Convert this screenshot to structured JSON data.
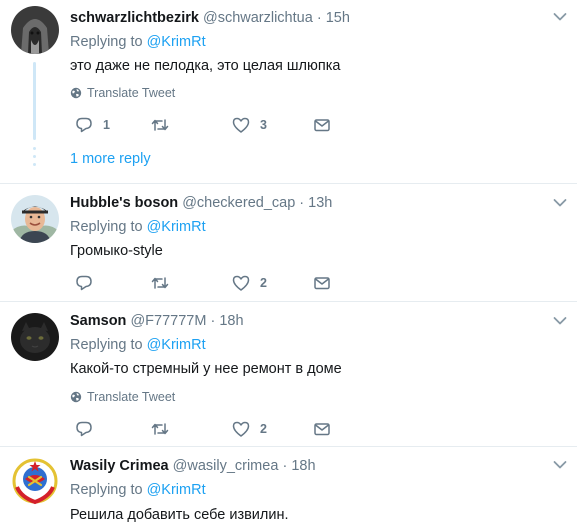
{
  "tweets": [
    {
      "name": "schwarzlichtbezirk",
      "handle": "@schwarzlichtua",
      "time": "15h",
      "replying_prefix": "Replying to",
      "mention": "@KrimRt",
      "text": "это даже не пелодка, это целая шлюпка",
      "translate": "Translate Tweet",
      "reply_count": "1",
      "retweet_count": "",
      "like_count": "3",
      "more_reply": "1 more reply"
    },
    {
      "name": "Hubble's boson",
      "handle": "@checkered_cap",
      "time": "13h",
      "replying_prefix": "Replying to",
      "mention": "@KrimRt",
      "text": "Громыко-style",
      "reply_count": "",
      "retweet_count": "",
      "like_count": "2"
    },
    {
      "name": "Samson",
      "handle": "@F77777M",
      "time": "18h",
      "replying_prefix": "Replying to",
      "mention": "@KrimRt",
      "text": "Какой-то стремный у нее ремонт в доме",
      "translate": "Translate Tweet",
      "reply_count": "",
      "retweet_count": "",
      "like_count": "2"
    },
    {
      "name": "Wasily Crimea",
      "handle": "@wasily_crimea",
      "time": "18h",
      "replying_prefix": "Replying to",
      "mention": "@KrimRt",
      "text": "Решила добавить себе извилин."
    }
  ],
  "separator": "·",
  "colors": {
    "accent": "#1da1f2",
    "muted": "#657786",
    "divider": "#e6ecf0",
    "thread": "#cfe7f7"
  },
  "icons": [
    "reply-icon",
    "retweet-icon",
    "like-icon",
    "message-icon",
    "globe-icon",
    "chevron-down-icon"
  ]
}
